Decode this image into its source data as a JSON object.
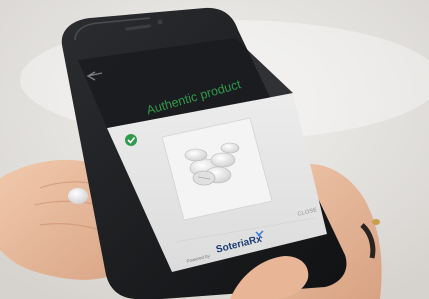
{
  "screen": {
    "title": "Authentic product",
    "close_label": "CLOSE",
    "powered_by": "Powered by",
    "brand": "SoteriaRx"
  },
  "icons": {
    "back": "back-arrow-icon",
    "verified": "check-circle-icon"
  },
  "colors": {
    "verified_green": "#2f9a4a",
    "brand_navy": "#1c3e73"
  }
}
